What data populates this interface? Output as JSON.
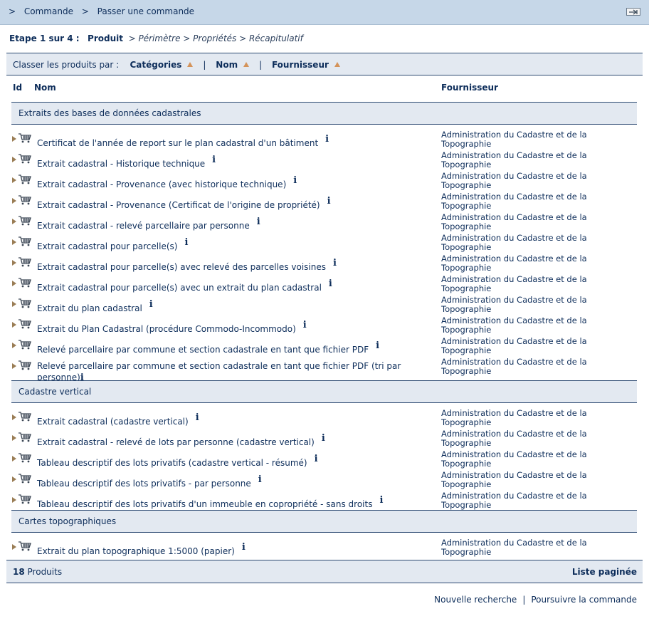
{
  "header": {
    "crumbs": [
      ">",
      "Commande",
      ">",
      "Passer une commande"
    ]
  },
  "steps": {
    "step_label": "Etape 1 sur 4 :",
    "current": "Produit",
    "rest": "> Périmètre > Propriétés > Récapitulatif"
  },
  "sort": {
    "label": "Classer les produits par :",
    "options": [
      "Catégories",
      "Nom",
      "Fournisseur"
    ],
    "separator": "|"
  },
  "columns": {
    "id": "Id",
    "name": "Nom",
    "supplier": "Fournisseur"
  },
  "supplier_line1": "Administration du Cadastre et de la",
  "supplier_line2": "Topographie",
  "info_glyph": "i",
  "groups": [
    {
      "title": "Extraits des bases de données cadastrales",
      "items": [
        "Certificat de l'année de report sur le plan cadastral d'un bâtiment",
        "Extrait cadastral - Historique technique",
        "Extrait cadastral - Provenance (avec historique technique)",
        "Extrait cadastral - Provenance (Certificat de l'origine de propriété)",
        "Extrait cadastral - relevé parcellaire par personne",
        "Extrait cadastral pour parcelle(s)",
        "Extrait cadastral pour parcelle(s) avec relevé des parcelles voisines",
        "Extrait cadastral pour parcelle(s) avec un extrait du plan cadastral",
        "Extrait du plan cadastral",
        "Extrait du Plan Cadastral (procédure Commodo-Incommodo)",
        "Relevé parcellaire par commune et section cadastrale en tant que fichier PDF",
        "Relevé parcellaire par commune et section cadastrale en tant que fichier PDF (tri par personne)"
      ]
    },
    {
      "title": "Cadastre vertical",
      "items": [
        "Extrait cadastral (cadastre vertical)",
        "Extrait cadastral - relevé de lots par personne (cadastre vertical)",
        "Tableau descriptif des lots privatifs (cadastre vertical - résumé)",
        "Tableau descriptif des lots privatifs - par personne",
        "Tableau descriptif des lots privatifs d'un immeuble en copropriété - sans droits"
      ]
    },
    {
      "title": "Cartes topographiques",
      "items": [
        "Extrait du plan topographique 1:5000 (papier)"
      ]
    }
  ],
  "footer": {
    "count": "18",
    "count_label": "Produits",
    "paged": "Liste paginée"
  },
  "actions": {
    "new_search": "Nouvelle recherche",
    "separator": "|",
    "continue": "Poursuivre la commande"
  },
  "colors": {
    "header_bg": "#c6d7e8",
    "band_bg": "#e3e9f1",
    "text": "#0d2d5a",
    "sort_arrow": "#d4935a"
  },
  "icons": {
    "cart": "shopping-cart-icon",
    "info": "info-icon",
    "expand": "play-triangle-icon",
    "exit": "exit-icon"
  }
}
